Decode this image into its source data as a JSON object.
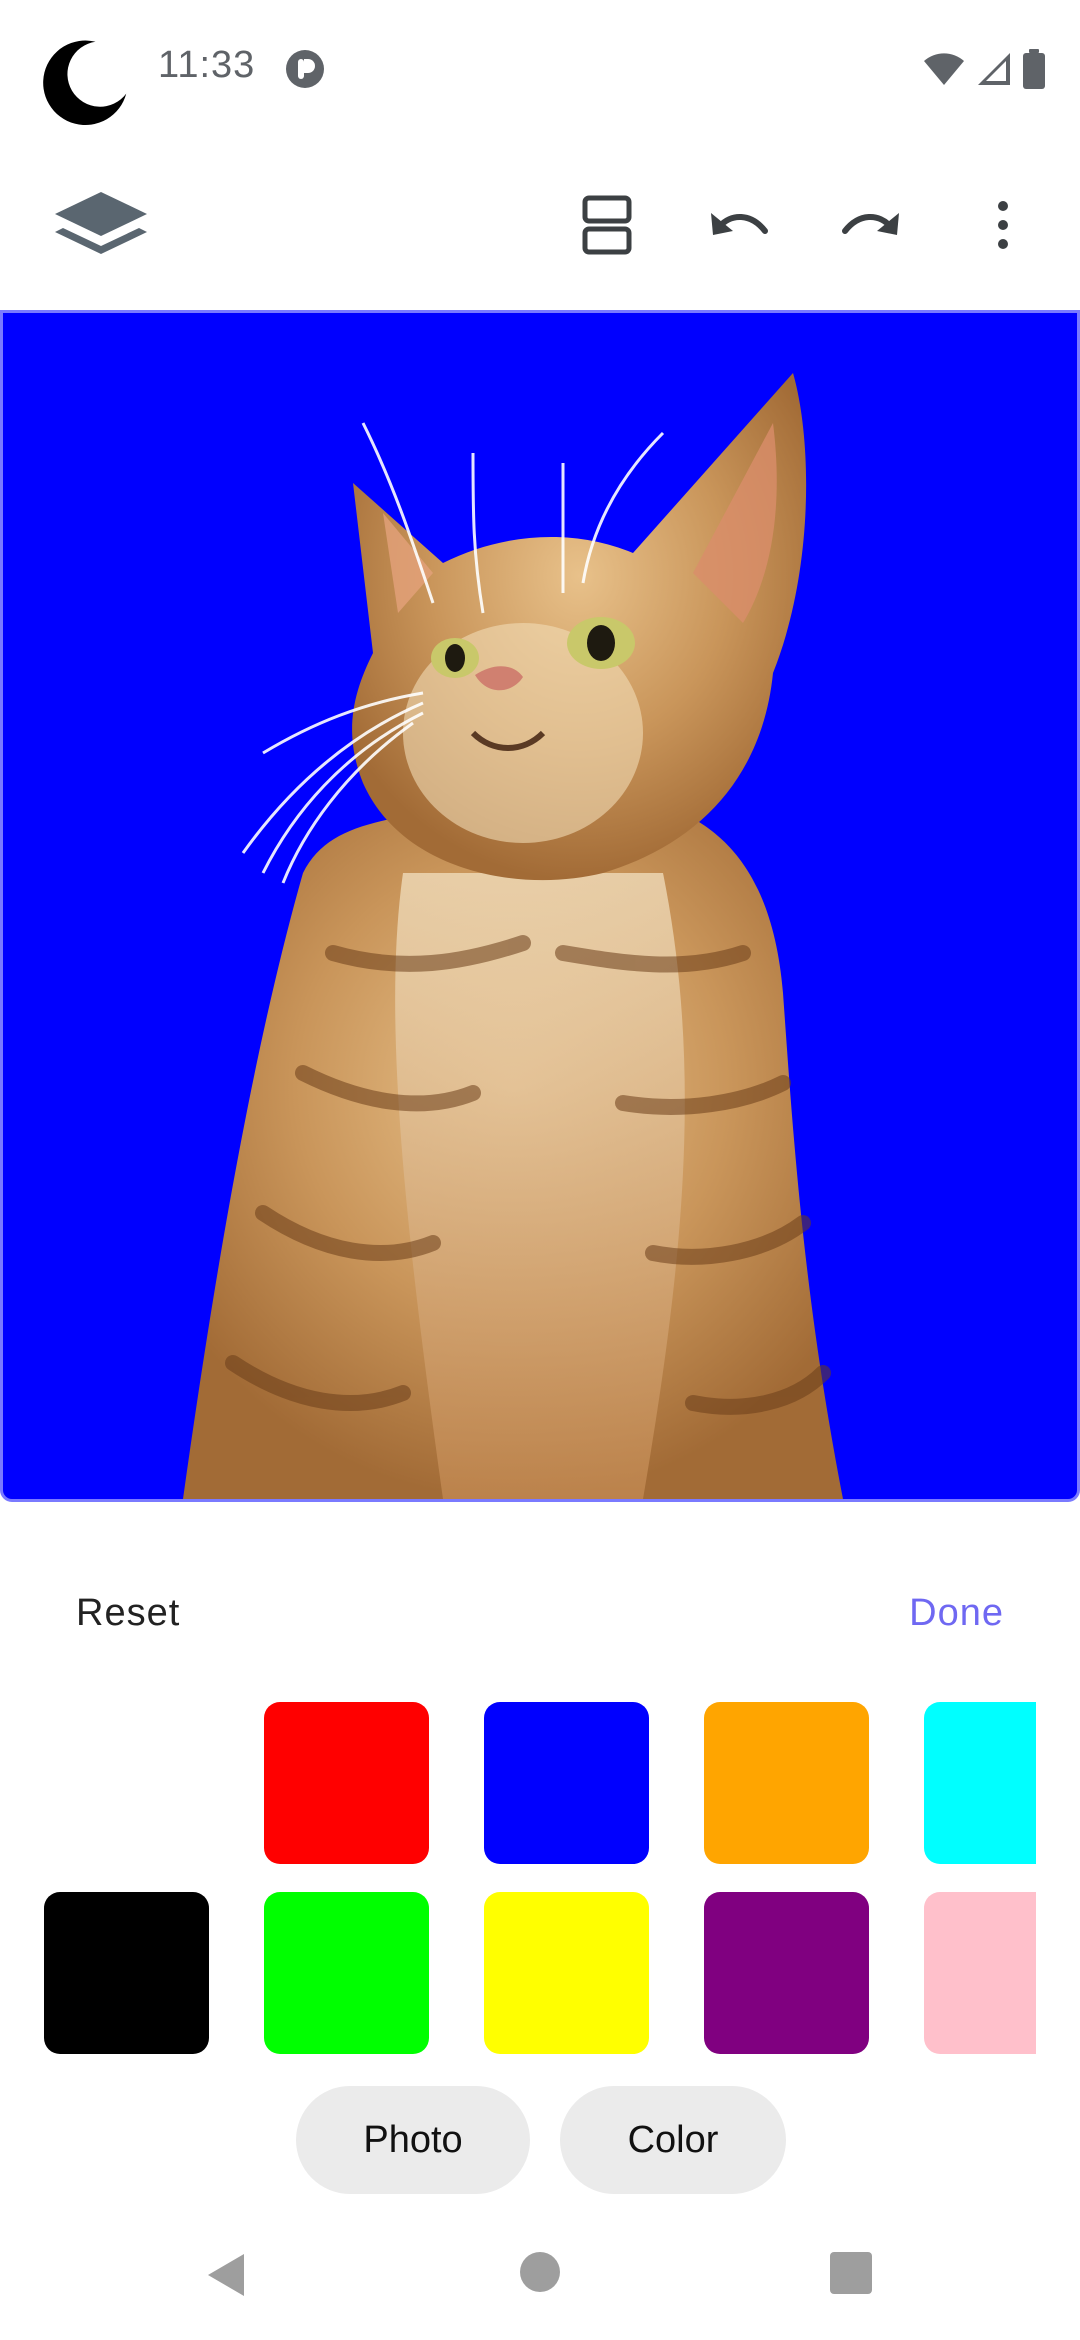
{
  "status_bar": {
    "time": "11:33",
    "icons": [
      "moon-icon",
      "notification-icon",
      "wifi-icon",
      "signal-icon",
      "battery-icon"
    ]
  },
  "toolbar": {
    "icons": [
      "layers-icon",
      "split-view-icon",
      "undo-icon",
      "redo-icon",
      "more-vert-icon"
    ]
  },
  "canvas": {
    "background_color": "#0000ff",
    "subject": "cat-photo-cutout"
  },
  "sheet": {
    "reset_label": "Reset",
    "done_label": "Done",
    "accent_color": "#6f68f2",
    "swatches_row1": [
      "transparent",
      "#ff0000",
      "#0000ff",
      "#ffa500",
      "#00ffff"
    ],
    "swatches_row2": [
      "#000000",
      "#00ff00",
      "#ffff00",
      "#800080",
      "#ffc0cb"
    ],
    "tabs": {
      "photo_label": "Photo",
      "color_label": "Color"
    }
  },
  "navbar": {
    "icons": [
      "back-icon",
      "home-icon",
      "recents-icon"
    ]
  }
}
